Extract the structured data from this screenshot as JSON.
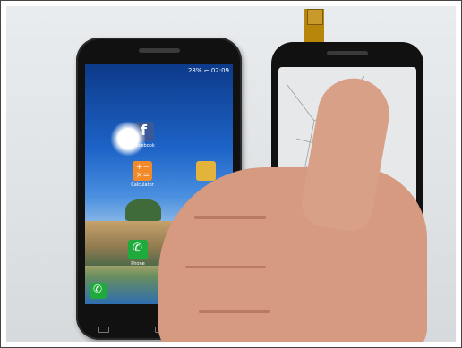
{
  "phone_left": {
    "status": "28% ⌐ 02:09",
    "apps": [
      "Facebook",
      "Calculator",
      "Phone"
    ]
  },
  "icons": [
    "phone-icon",
    "facebook-icon",
    "calculator-icon"
  ],
  "colors": {
    "background": "#e3e6e8",
    "skin": "#d59a80",
    "flex_cable": "#b8860b"
  }
}
